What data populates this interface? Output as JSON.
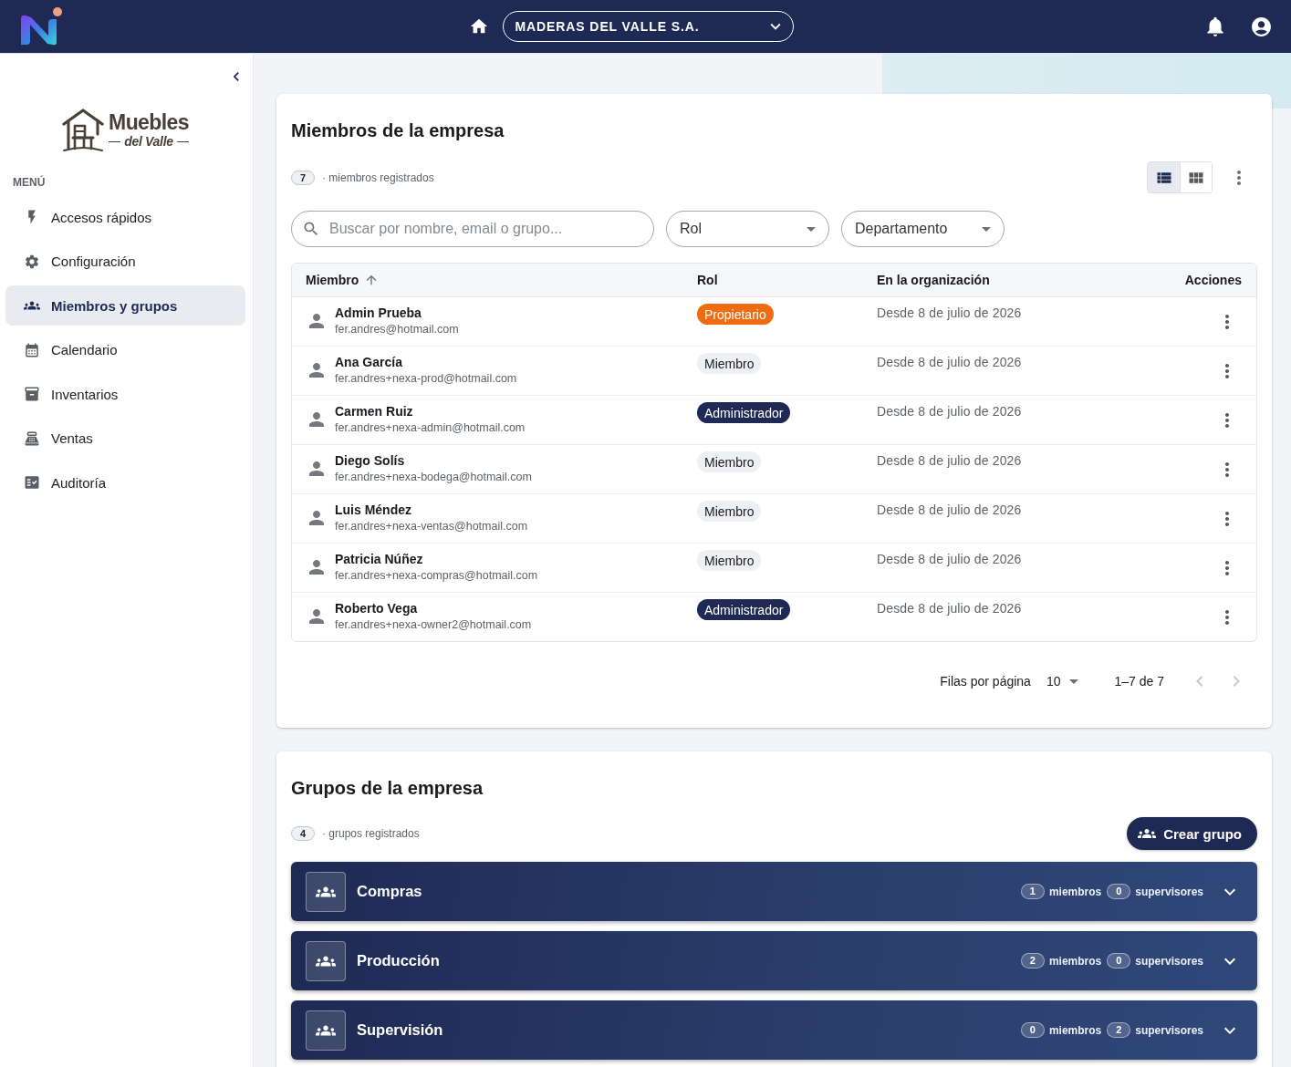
{
  "top_bar": {
    "company": "MADERAS DEL VALLE S.A."
  },
  "sidebar": {
    "logo": {
      "title": "Muebles",
      "subtitle": "del Valle"
    },
    "menu_heading": "MENÚ",
    "items": [
      {
        "label": "Accesos rápidos",
        "kind": "shortcuts",
        "selected": false
      },
      {
        "label": "Configuración",
        "kind": "settings",
        "selected": false
      },
      {
        "label": "Miembros y grupos",
        "kind": "members",
        "selected": true
      },
      {
        "label": "Calendario",
        "kind": "calendar",
        "selected": false
      },
      {
        "label": "Inventarios",
        "kind": "inventory",
        "selected": false
      },
      {
        "label": "Ventas",
        "kind": "sales",
        "selected": false
      },
      {
        "label": "Auditoría",
        "kind": "audit",
        "selected": false
      }
    ]
  },
  "members": {
    "title": "Miembros de la empresa",
    "count": "7",
    "count_label": "· miembros registrados",
    "views": [
      {
        "kind": "list",
        "selected": true
      },
      {
        "kind": "grid",
        "selected": false
      }
    ],
    "search": {
      "placeholder": "Buscar por nombre, email o grupo..."
    },
    "filters": [
      {
        "label": "Rol"
      },
      {
        "label": "Departamento"
      }
    ],
    "table": {
      "columns": [
        {
          "label": "Miembro",
          "sorted": true
        },
        {
          "label": "Rol",
          "sorted": false
        },
        {
          "label": "En la organización",
          "sorted": false
        },
        {
          "label": "Acciones",
          "sorted": false
        }
      ],
      "rows": [
        {
          "name": "Admin Prueba",
          "email": "fer.andres@hotmail.com",
          "role": {
            "label": "Propietario",
            "kind": "owner"
          },
          "since": "Desde 8 de julio de 2026"
        },
        {
          "name": "Ana García",
          "email": "fer.andres+nexa-prod@hotmail.com",
          "role": {
            "label": "Miembro",
            "kind": "member"
          },
          "since": "Desde 8 de julio de 2026"
        },
        {
          "name": "Carmen Ruiz",
          "email": "fer.andres+nexa-admin@hotmail.com",
          "role": {
            "label": "Administrador",
            "kind": "admin"
          },
          "since": "Desde 8 de julio de 2026"
        },
        {
          "name": "Diego Solís",
          "email": "fer.andres+nexa-bodega@hotmail.com",
          "role": {
            "label": "Miembro",
            "kind": "member"
          },
          "since": "Desde 8 de julio de 2026"
        },
        {
          "name": "Luis Méndez",
          "email": "fer.andres+nexa-ventas@hotmail.com",
          "role": {
            "label": "Miembro",
            "kind": "member"
          },
          "since": "Desde 8 de julio de 2026"
        },
        {
          "name": "Patricia Núñez",
          "email": "fer.andres+nexa-compras@hotmail.com",
          "role": {
            "label": "Miembro",
            "kind": "member"
          },
          "since": "Desde 8 de julio de 2026"
        },
        {
          "name": "Roberto Vega",
          "email": "fer.andres+nexa-owner2@hotmail.com",
          "role": {
            "label": "Administrador",
            "kind": "admin"
          },
          "since": "Desde 8 de julio de 2026"
        }
      ]
    },
    "pagination": {
      "rows_label": "Filas por página",
      "rows_per_page": "10",
      "range": "1–7 de 7",
      "previous": {
        "disabled": true
      },
      "next": {
        "disabled": true
      }
    }
  },
  "groups": {
    "title": "Grupos de la empresa",
    "count": "4",
    "count_label": "· grupos registrados",
    "create_button": "Crear grupo",
    "items": [
      {
        "name": "Compras",
        "members": "1",
        "members_label": "miembros",
        "supervisors": "0",
        "supervisors_label": "supervisores",
        "expanded": false
      },
      {
        "name": "Producción",
        "members": "2",
        "members_label": "miembros",
        "supervisors": "0",
        "supervisors_label": "supervisores",
        "expanded": false
      },
      {
        "name": "Supervisión",
        "members": "0",
        "members_label": "miembros",
        "supervisors": "2",
        "supervisors_label": "supervisores",
        "expanded": false
      }
    ]
  }
}
